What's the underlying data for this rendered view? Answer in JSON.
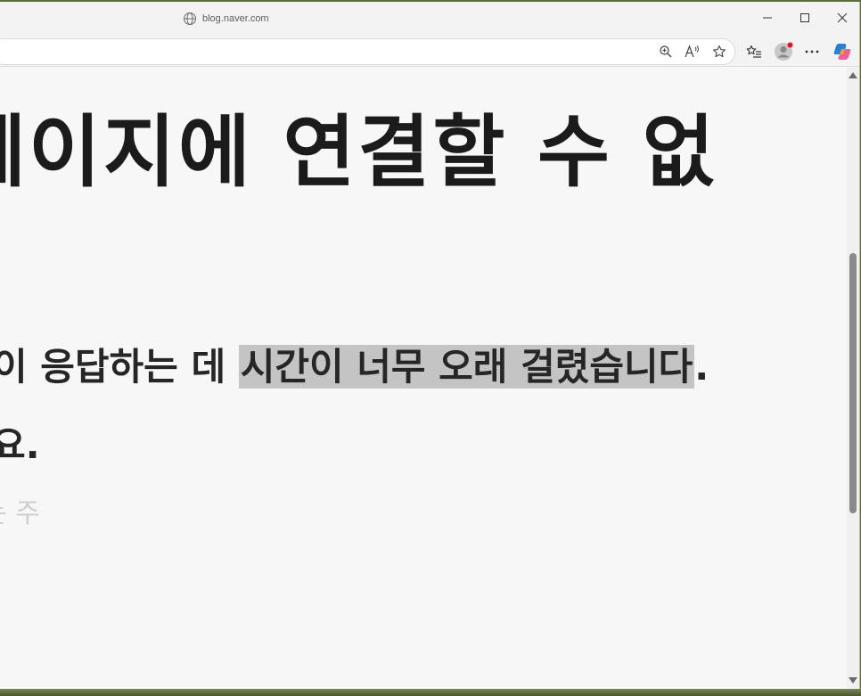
{
  "titlebar": {
    "site_url": "blog.naver.com"
  },
  "toolbar": {
    "icons": [
      "zoom-icon",
      "read-aloud-icon",
      "favorite-star-icon",
      "favorites-list-icon",
      "profile-icon",
      "more-icon",
      "copilot-icon"
    ],
    "profile_badge_color": "#e81123"
  },
  "page": {
    "title": "페이지에 연결할 수 없",
    "line1_prefix": "이 응답하는 데 ",
    "line1_highlight": "시간이 너무 오래 걸렸습니다",
    "line1_suffix": ".",
    "line2": "요.",
    "line3": "는 주"
  },
  "colors": {
    "page_bg": "#f7f7f7",
    "highlight": "#c4c4c4",
    "heading": "#1b1b1b"
  }
}
